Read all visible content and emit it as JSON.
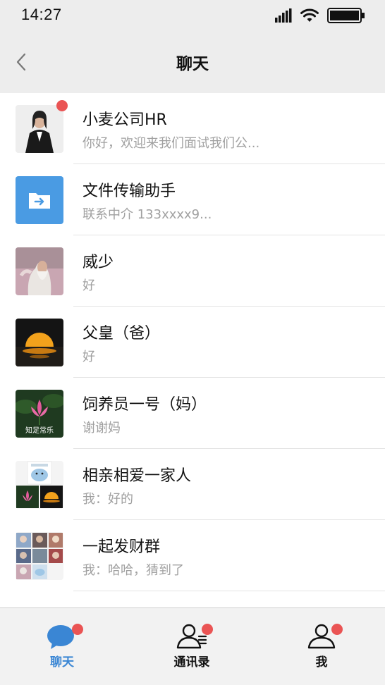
{
  "status_bar": {
    "time": "14:27"
  },
  "nav": {
    "title": "聊天"
  },
  "chats": [
    {
      "name": "小麦公司HR",
      "preview": "你好，欢迎来我们面试我们公...",
      "unread_dot": true
    },
    {
      "name": "文件传输助手",
      "preview": "联系中介 133xxxx9..."
    },
    {
      "name": "威少",
      "preview": "好"
    },
    {
      "name": "父皇（爸）",
      "preview": "好"
    },
    {
      "name": "饲养员一号（妈）",
      "preview": "谢谢妈",
      "avatar_caption": "知足常乐"
    },
    {
      "name": "相亲相爱一家人",
      "preview": "我：好的"
    },
    {
      "name": "一起发财群",
      "preview": "我：哈哈，猜到了"
    }
  ],
  "tabs": [
    {
      "label": "聊天",
      "icon": "chat-bubble-icon",
      "active": true
    },
    {
      "label": "通讯录",
      "icon": "contacts-icon"
    },
    {
      "label": "我",
      "icon": "person-icon"
    }
  ],
  "colors": {
    "accent": "#3a86d4",
    "badge": "#ea5454",
    "file_helper": "#4a9be3"
  }
}
